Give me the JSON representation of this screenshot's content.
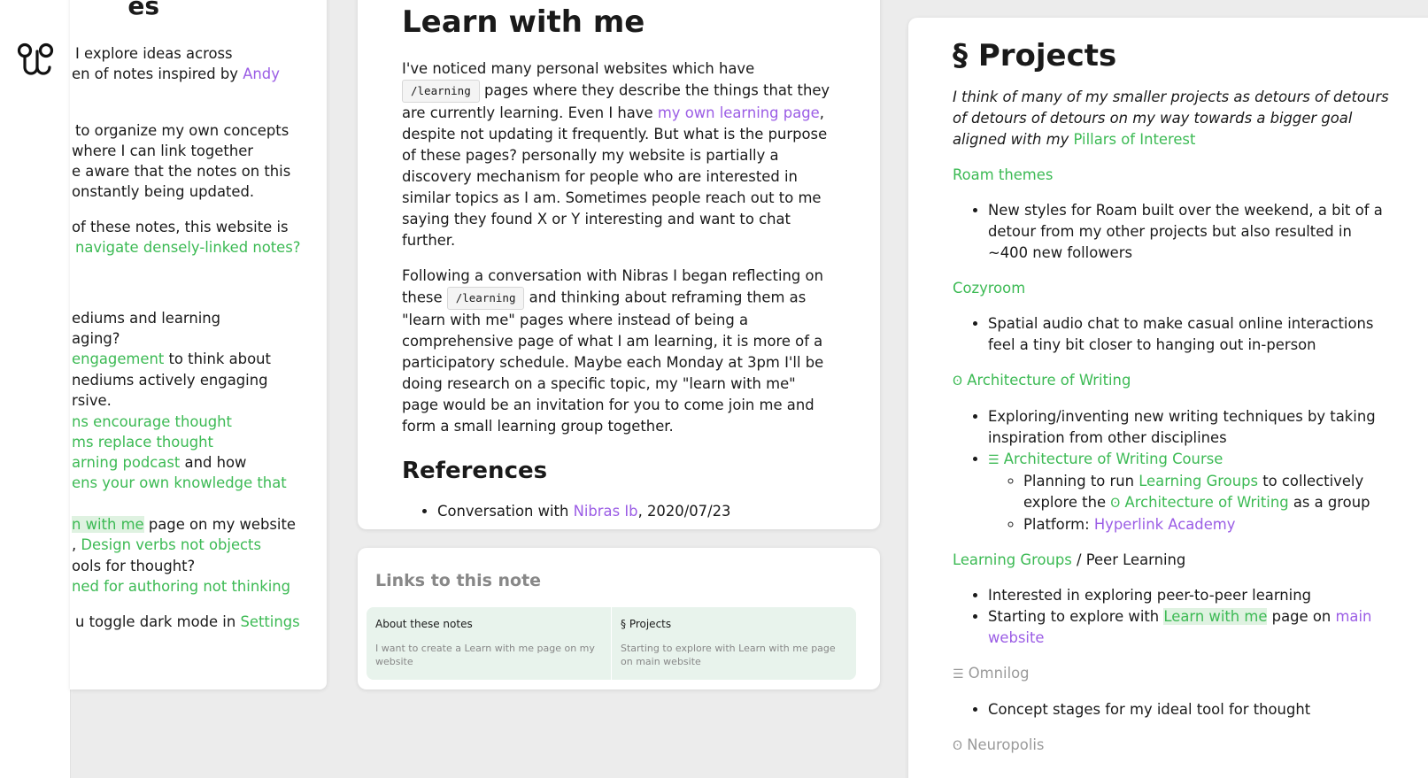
{
  "left_pane": {
    "title_tail": "es",
    "lines": [
      {
        "a": "I explore ideas across"
      },
      {
        "a": "en of notes inspired by ",
        "link": "Andy",
        "link_color": "purple"
      },
      {
        "a": "to organize my own concepts"
      },
      {
        "a": "where I can link together"
      },
      {
        "a": "e aware that the notes on this"
      },
      {
        "a": "onstantly being updated."
      },
      {
        "a": "of these notes, this website is"
      },
      {
        "link": "navigate densely-linked notes?",
        "link_color": "green"
      },
      {
        "a": "ediums and learning"
      },
      {
        "a": "aging?"
      },
      {
        "link": "engagement",
        "link_color": "green",
        "b": " to think about"
      },
      {
        "a": "nediums actively engaging"
      },
      {
        "a": "rsive."
      },
      {
        "link": "ns encourage thought",
        "link_color": "green"
      },
      {
        "link": "ms replace thought",
        "link_color": "green"
      },
      {
        "link": "arning podcast",
        "link_color": "green",
        "b": " and how"
      },
      {
        "link": "ens your own knowledge that",
        "link_color": "green"
      },
      {
        "link": "n with me",
        "link_color": "green-hl",
        "b": " page on my website"
      },
      {
        "a": ", ",
        "link": "Design verbs not objects",
        "link_color": "green"
      },
      {
        "a": "ools for thought?"
      },
      {
        "link": "ned for authoring not thinking",
        "link_color": "green"
      },
      {
        "a": "u toggle dark mode in ",
        "link": "Settings",
        "link_color": "green"
      }
    ]
  },
  "note": {
    "title": "Learn with me",
    "p1_a": "I've noticed many personal websites which have ",
    "p1_code": "/learning",
    "p1_b": " pages where they describe the things that they are currently learning. Even I have ",
    "p1_link": "my own learning page",
    "p1_c": ", despite not updating it frequently. But what is the purpose of these pages? personally my website is partially a discovery mechanism for people who are interested in similar topics as I am. Sometimes people reach out to me saying they found X or Y interesting and want to chat further.",
    "p2_a": "Following a conversation with Nibras I began reflecting on these ",
    "p2_code": "/learning",
    "p2_b": " and thinking about reframing them as \"learn with me\" pages where instead of being a comprehensive page of what I am learning, it is more of a participatory schedule. Maybe each Monday at 3pm I'll be doing research on a specific topic, my \"learn with me\" page would be an invitation for you to come join me and form a small learning group together.",
    "refs_title": "References",
    "ref_a": "Conversation with ",
    "ref_link": "Nibras Ib",
    "ref_b": ", 2020/07/23"
  },
  "backlinks": {
    "title": "Links to this note",
    "cards": [
      {
        "title": "About these notes",
        "snippet": "I want to create a Learn with me page on my website"
      },
      {
        "title": "§ Projects",
        "snippet": "Starting to explore with Learn with me page on main website"
      }
    ]
  },
  "projects": {
    "title": "§ Projects",
    "intro": "I think of many of my smaller projects as detours of detours of detours of detours on my way towards a bigger goal aligned with my ",
    "intro_link": "Pillars of Interest",
    "roam_title": "Roam themes",
    "roam_item": "New styles for Roam built over the weekend, a bit of a detour from my other projects but also resulted in ~400 new followers",
    "cozy_title": "Cozyroom",
    "cozy_item": "Spatial audio chat to make casual online interactions feel a tiny bit closer to hanging out in-person",
    "aow_icon": "ʘ",
    "aow_title": "Architecture of Writing",
    "aow_item1": "Exploring/inventing new writing techniques by taking inspiration from other disciplines",
    "aowc_icon": "☰",
    "aowc_title": "Architecture of Writing Course",
    "sub1_a": "Planning to run ",
    "sub1_link1": "Learning Groups",
    "sub1_b": " to collectively explore the ",
    "sub1_icon": "ʘ",
    "sub1_link2": "Architecture of Writing",
    "sub1_c": " as a group",
    "sub2_a": "Platform: ",
    "sub2_link": "Hyperlink Academy",
    "lg_link": "Learning Groups",
    "lg_rest": " / Peer Learning",
    "lg_item1": "Interested in exploring peer-to-peer learning",
    "lg_item2_a": "Starting to explore with ",
    "lg_item2_link": "Learn with me",
    "lg_item2_b": " page on ",
    "lg_item2_link2": "main website",
    "omni_icon": "☰",
    "omni_title": "Omnilog",
    "omni_item": "Concept stages for my ideal tool for thought",
    "neuro_icon": "ʘ",
    "neuro_title": "Neuropolis"
  }
}
